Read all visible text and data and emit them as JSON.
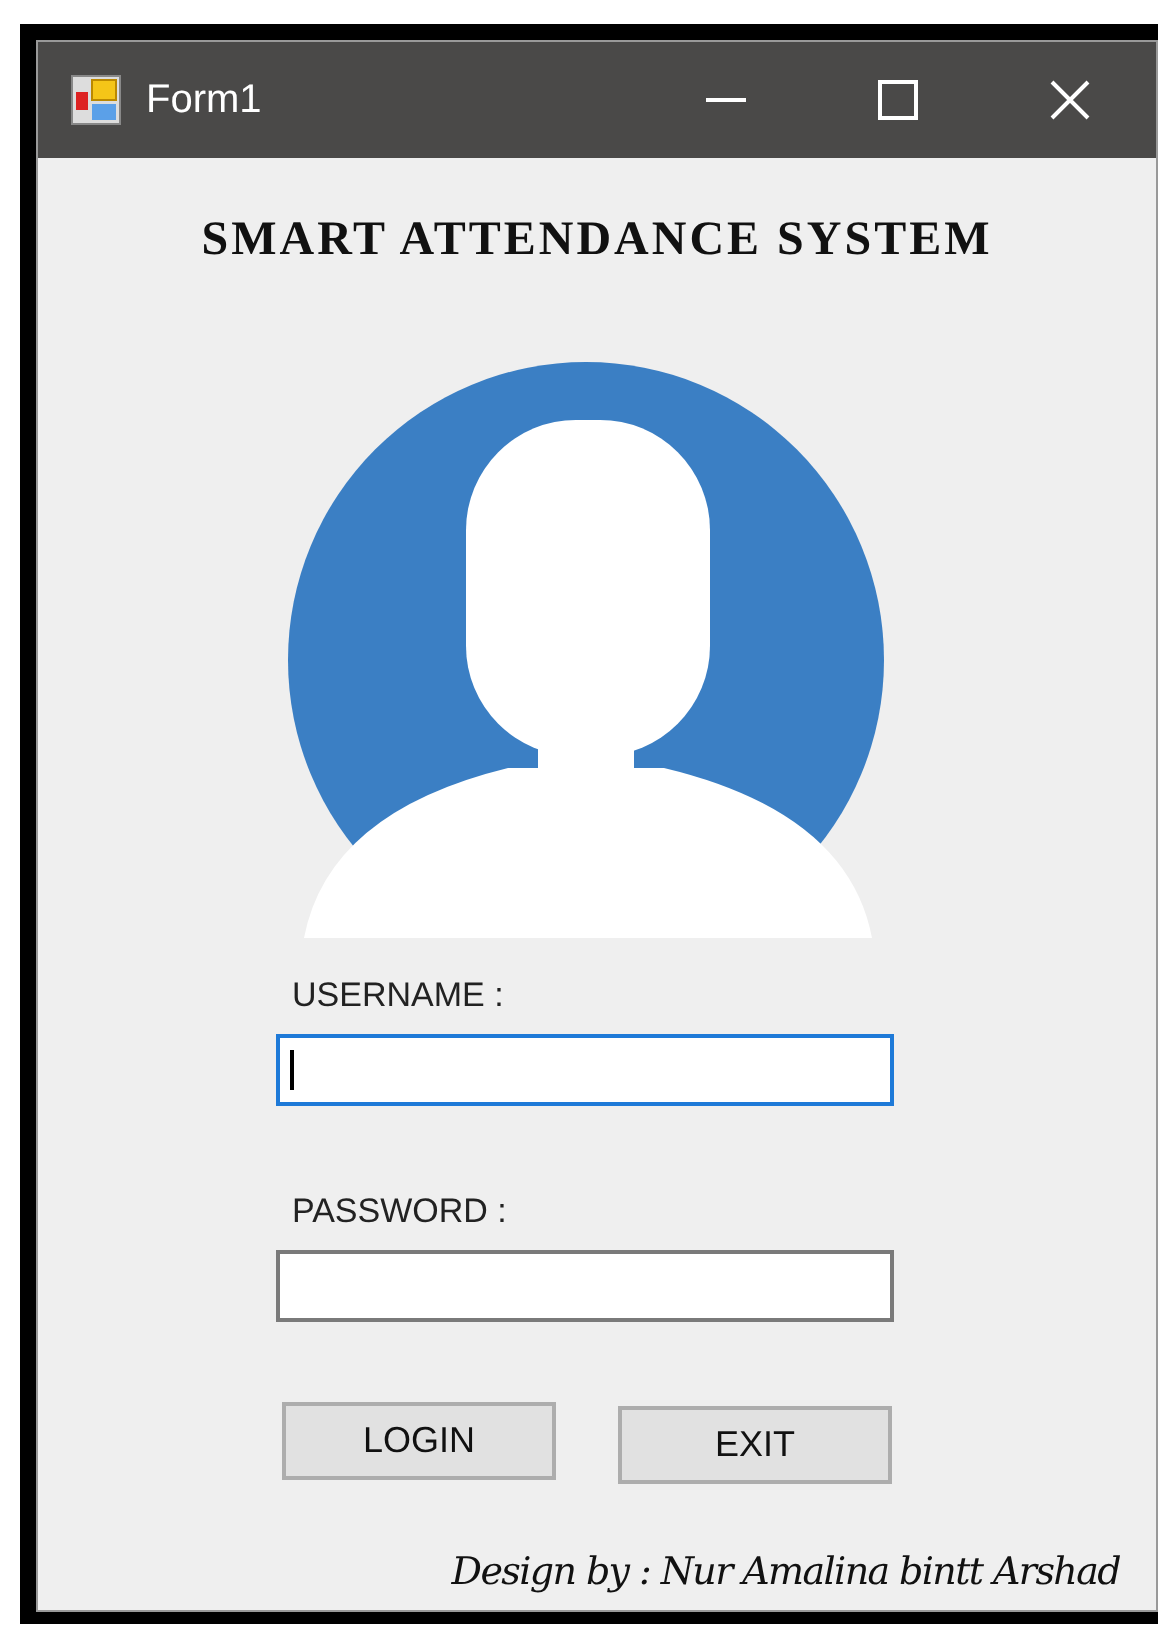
{
  "window": {
    "title": "Form1"
  },
  "heading": "SMART ATTENDANCE SYSTEM",
  "fields": [
    {
      "label": "USERNAME :",
      "focused": true
    },
    {
      "label": "PASSWORD :",
      "focused": false
    }
  ],
  "buttons": [
    "LOGIN",
    "EXIT"
  ],
  "footer": "Design by : Nur Amalina bintt Arshad"
}
